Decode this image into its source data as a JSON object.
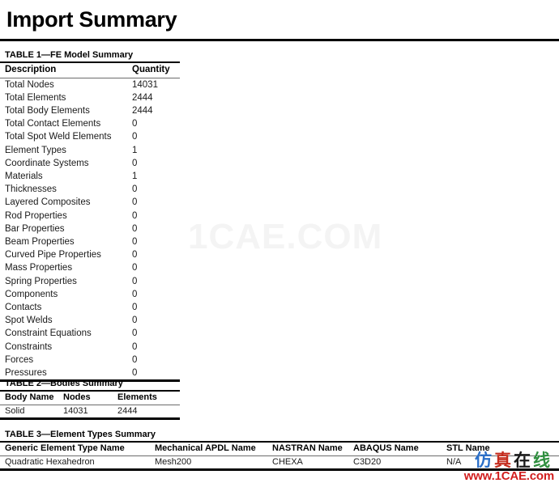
{
  "document": {
    "title": "Import Summary"
  },
  "table1": {
    "caption": "TABLE 1—FE Model Summary",
    "columns": [
      "Description",
      "Quantity"
    ],
    "rows": [
      [
        "Total Nodes",
        "14031"
      ],
      [
        "Total Elements",
        "2444"
      ],
      [
        "Total Body Elements",
        "2444"
      ],
      [
        "Total Contact Elements",
        "0"
      ],
      [
        "Total Spot Weld Elements",
        "0"
      ],
      [
        "Element Types",
        "1"
      ],
      [
        "Coordinate Systems",
        "0"
      ],
      [
        "Materials",
        "1"
      ],
      [
        "Thicknesses",
        "0"
      ],
      [
        "Layered Composites",
        "0"
      ],
      [
        "Rod Properties",
        "0"
      ],
      [
        "Bar Properties",
        "0"
      ],
      [
        "Beam Properties",
        "0"
      ],
      [
        "Curved Pipe Properties",
        "0"
      ],
      [
        "Mass Properties",
        "0"
      ],
      [
        "Spring Properties",
        "0"
      ],
      [
        "Components",
        "0"
      ],
      [
        "Contacts",
        "0"
      ],
      [
        "Spot Welds",
        "0"
      ],
      [
        "Constraint Equations",
        "0"
      ],
      [
        "Constraints",
        "0"
      ],
      [
        "Forces",
        "0"
      ],
      [
        "Pressures",
        "0"
      ]
    ]
  },
  "table2": {
    "caption": "TABLE 2—Bodies Summary",
    "columns": [
      "Body Name",
      "Nodes",
      "Elements"
    ],
    "rows": [
      [
        "Solid",
        "14031",
        "2444"
      ]
    ]
  },
  "table3": {
    "caption": "TABLE 3—Element Types Summary",
    "columns": [
      "Generic Element Type Name",
      "Mechanical APDL Name",
      "NASTRAN Name",
      "ABAQUS Name",
      "STL Name"
    ],
    "rows": [
      [
        "Quadratic Hexahedron",
        "Mesh200",
        "CHEXA",
        "C3D20",
        "N/A"
      ]
    ]
  },
  "watermarks": {
    "background_text": "1CAE.COM",
    "background_color": "#f4f4f4",
    "logo_chars": [
      "仿",
      "真",
      "在",
      "线"
    ],
    "logo_char_colors": [
      "#2a6fc9",
      "#c42c1e",
      "#1b1b1b",
      "#2f8f3f"
    ],
    "logo_url": "www.1CAE.com",
    "logo_url_color": "#d21f1f"
  }
}
